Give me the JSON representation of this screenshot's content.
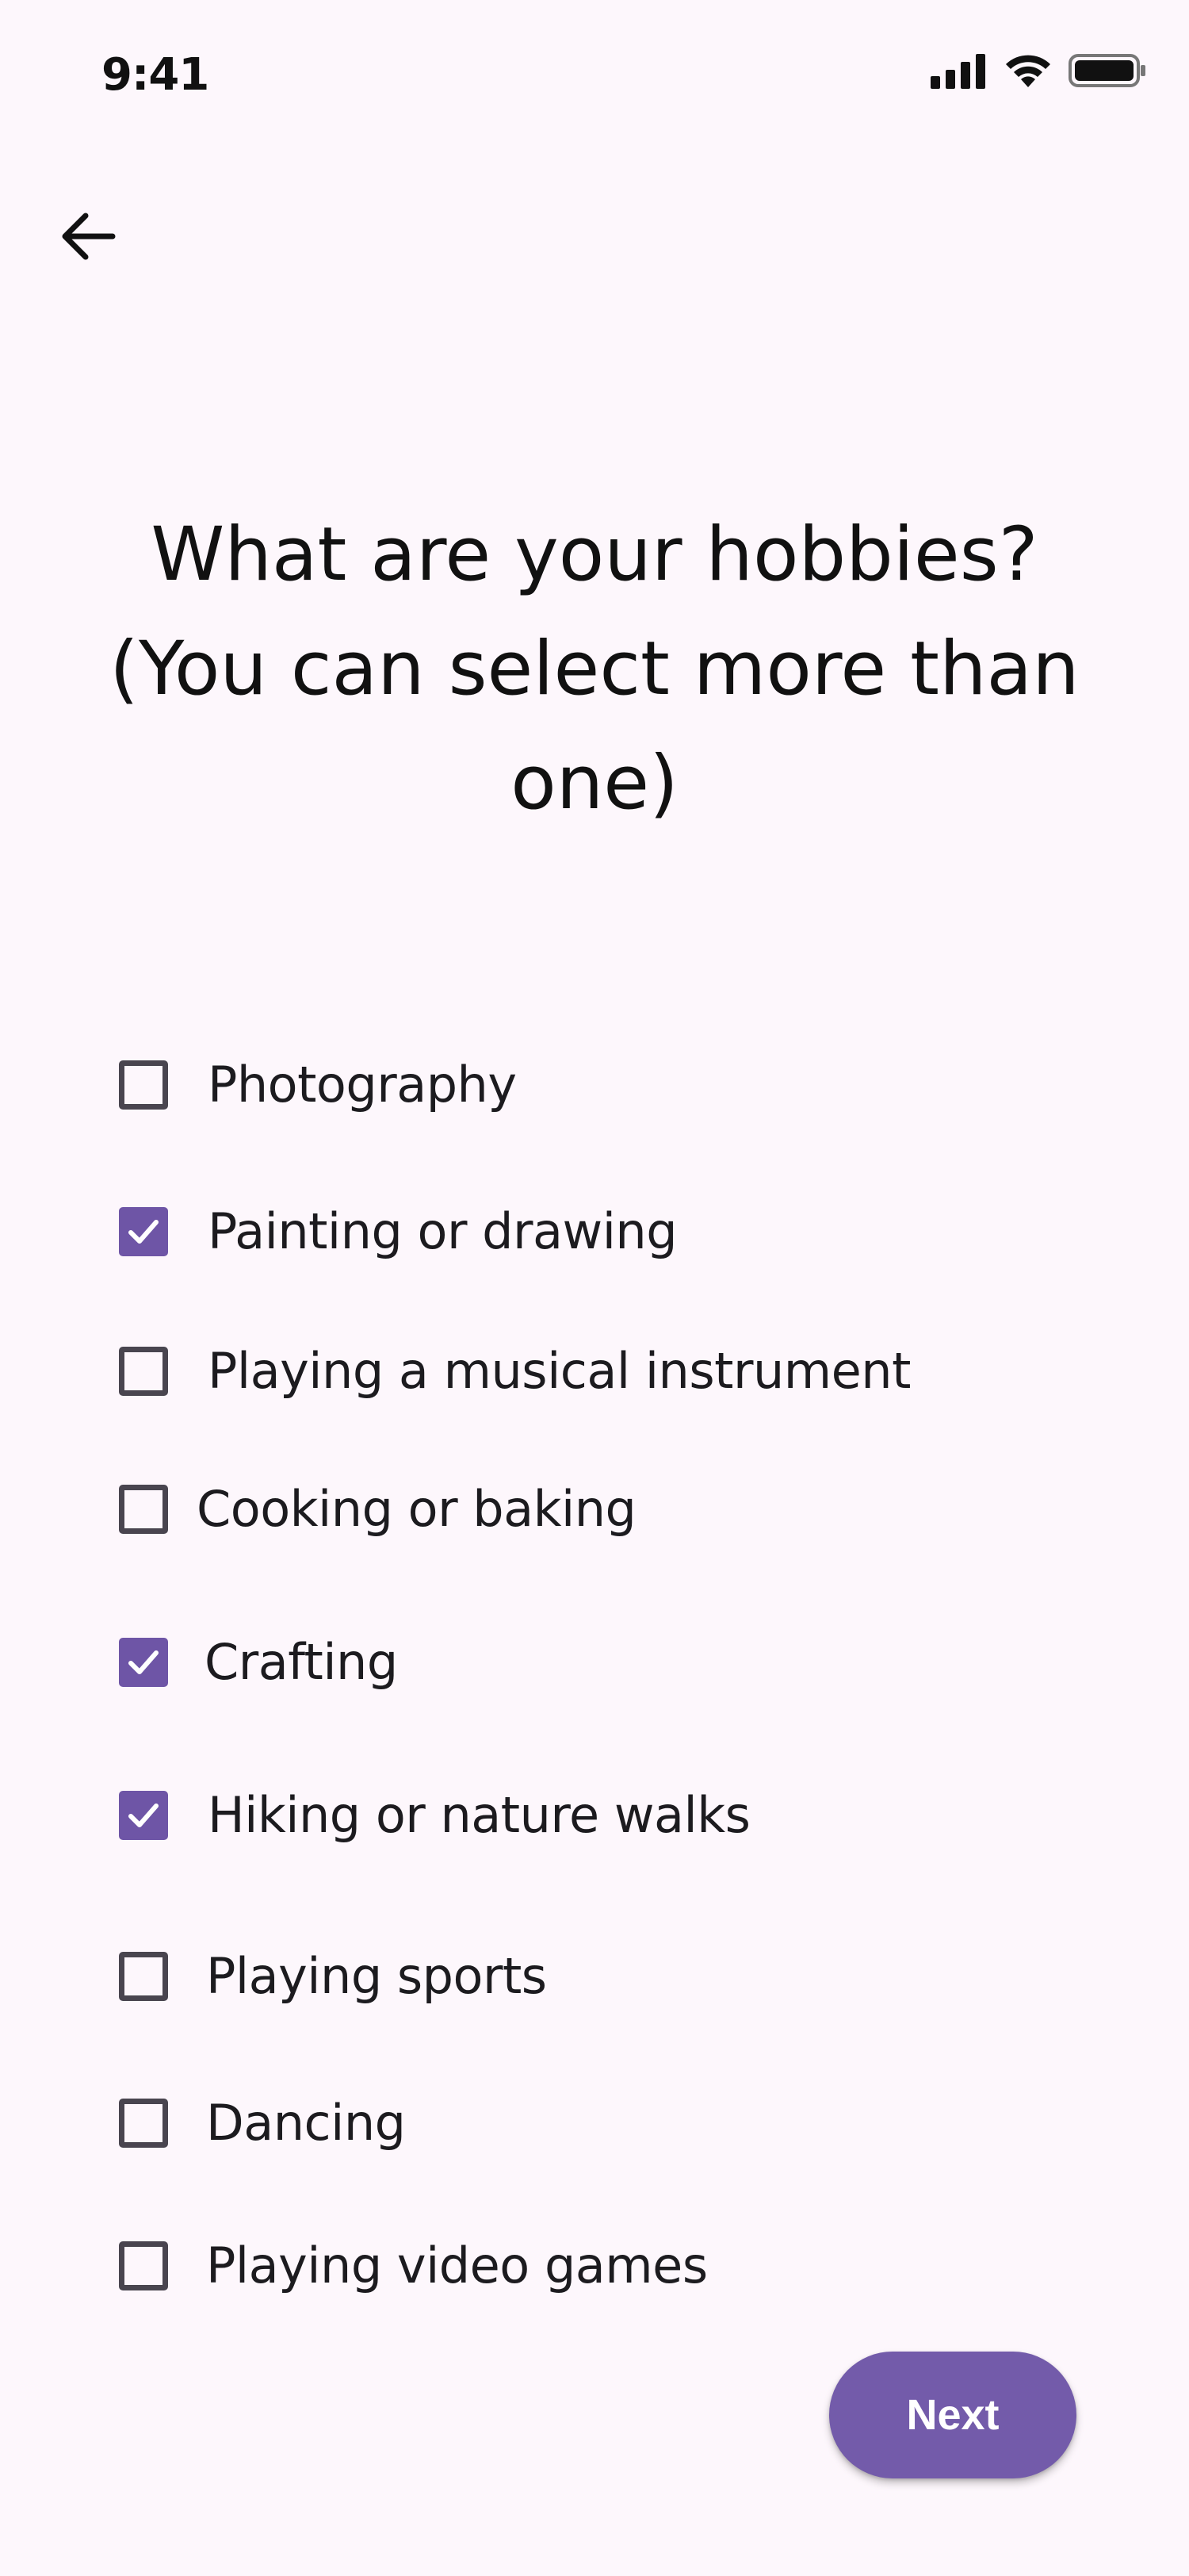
{
  "status_bar": {
    "time": "9:41",
    "icons": [
      "cellular-signal-icon",
      "wifi-icon",
      "battery-icon"
    ]
  },
  "header": {
    "back_icon": "arrow-left-icon"
  },
  "main": {
    "title_lines": [
      "What are your hobbies?",
      "(You can select more than",
      "one)"
    ]
  },
  "options": [
    {
      "label": "Photography",
      "checked": false
    },
    {
      "label": "Painting or drawing",
      "checked": true
    },
    {
      "label": "Playing a musical instrument",
      "checked": false
    },
    {
      "label": "Cooking or baking",
      "checked": false
    },
    {
      "label": "Crafting",
      "checked": true
    },
    {
      "label": "Hiking or nature walks",
      "checked": true
    },
    {
      "label": "Playing sports",
      "checked": false
    },
    {
      "label": "Dancing",
      "checked": false
    },
    {
      "label": "Playing video games",
      "checked": false
    }
  ],
  "footer": {
    "next_label": "Next"
  },
  "colors": {
    "background": "#FDF7FC",
    "accent": "#735BAA",
    "checkbox_checked": "#6E55A6",
    "checkbox_border": "#49454F"
  }
}
